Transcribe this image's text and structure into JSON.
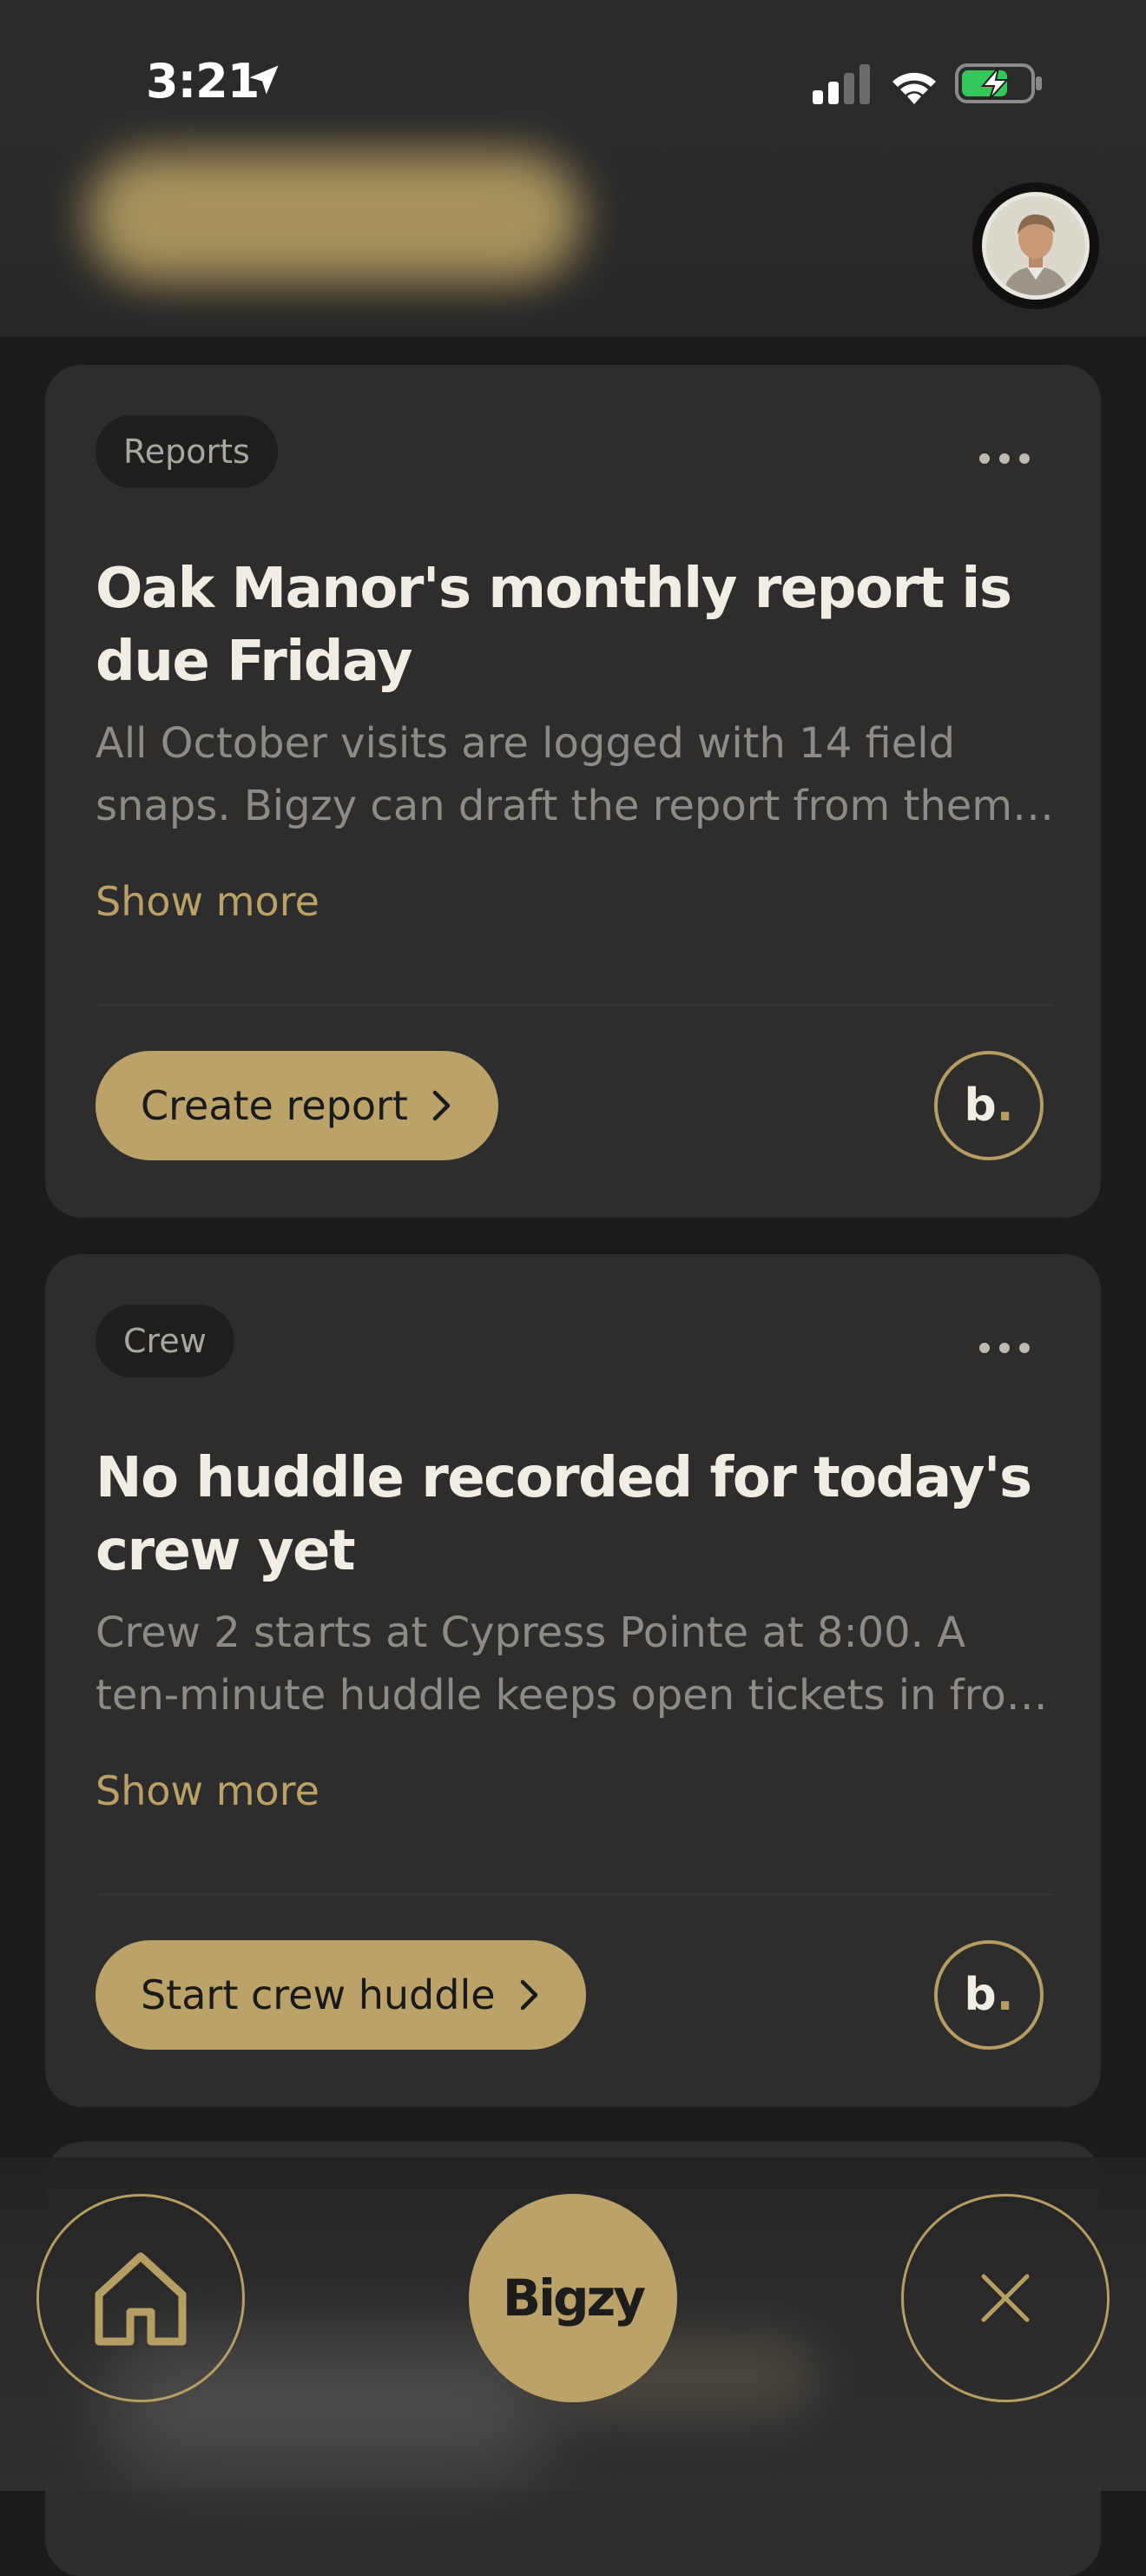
{
  "status_bar": {
    "time": "3:21"
  },
  "cards": [
    {
      "tag": "Reports",
      "title": "Oak Manor's monthly report is due Friday",
      "body": "All October visits are logged with 14 field snaps. Bigzy can draft the report from them…",
      "show_more": "Show more",
      "cta": "Create report",
      "badge": "b",
      "badge_dot": "."
    },
    {
      "tag": "Crew",
      "title": "No huddle recorded for today's crew yet",
      "body": "Crew 2 starts at Cypress Pointe at 8:00. A ten-minute huddle keeps open tickets in fro…",
      "show_more": "Show more",
      "cta": "Start crew huddle",
      "badge": "b",
      "badge_dot": "."
    }
  ],
  "nav": {
    "center_label": "Bigzy"
  },
  "icons": {
    "location": "location-arrow-icon",
    "signal": "cellular-signal-icon",
    "wifi": "wifi-icon",
    "battery": "battery-charging-icon",
    "more": "more-dots-icon",
    "chevron": "chevron-right-icon",
    "home": "home-icon",
    "close": "close-icon"
  },
  "colors": {
    "accent": "#baa269",
    "background": "#1b1b1a",
    "card": "#2d2d2d",
    "battery_green": "#34c759"
  }
}
